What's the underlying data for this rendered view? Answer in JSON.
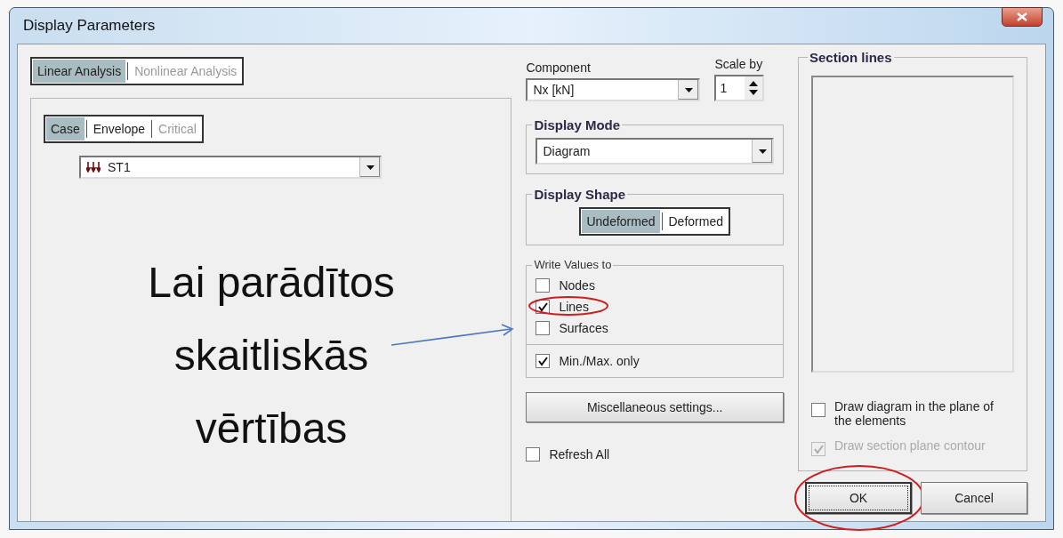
{
  "window": {
    "title": "Display Parameters"
  },
  "analysis_tabs": [
    {
      "label": "Linear Analysis",
      "selected": true,
      "disabled": false
    },
    {
      "label": "Nonlinear Analysis",
      "selected": false,
      "disabled": true
    }
  ],
  "result_tabs": [
    {
      "label": "Case",
      "selected": true,
      "disabled": false
    },
    {
      "label": "Envelope",
      "selected": false,
      "disabled": false
    },
    {
      "label": "Critical",
      "selected": false,
      "disabled": true
    }
  ],
  "load_case": {
    "value": "ST1"
  },
  "component": {
    "label": "Component",
    "value": "Nx [kN]"
  },
  "scale": {
    "label": "Scale by",
    "value": "1"
  },
  "display_mode": {
    "title": "Display Mode",
    "value": "Diagram"
  },
  "display_shape": {
    "title": "Display Shape",
    "options": [
      {
        "label": "Undeformed",
        "selected": true
      },
      {
        "label": "Deformed",
        "selected": false
      }
    ]
  },
  "write_values": {
    "title": "Write Values to",
    "options": [
      {
        "label": "Nodes",
        "checked": false,
        "circled": false
      },
      {
        "label": "Lines",
        "checked": true,
        "circled": true
      },
      {
        "label": "Surfaces",
        "checked": false,
        "circled": false
      }
    ]
  },
  "minmax": {
    "label": "Min./Max. only",
    "checked": true
  },
  "misc_button": "Miscellaneous settings...",
  "refresh_all": {
    "label": "Refresh All",
    "checked": false
  },
  "section_lines": {
    "title": "Section lines",
    "options": [
      {
        "label": "Draw diagram in the plane of the elements",
        "checked": false,
        "disabled": false
      },
      {
        "label": "Draw section plane contour",
        "checked": true,
        "disabled": true
      }
    ]
  },
  "buttons": [
    {
      "label": "OK",
      "default": true,
      "circled": true
    },
    {
      "label": "Cancel",
      "default": false,
      "circled": false
    }
  ],
  "annotation": {
    "lines": [
      "Lai parādītos",
      "skaitliskās",
      "vērtības"
    ]
  }
}
